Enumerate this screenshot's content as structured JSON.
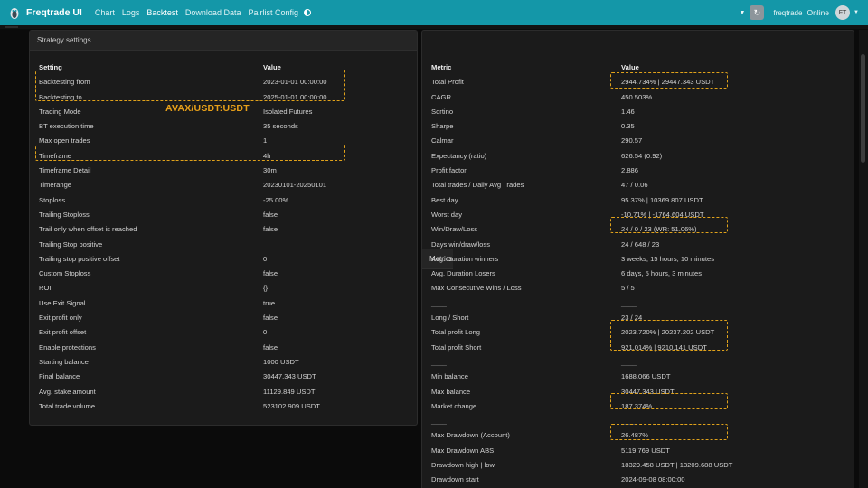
{
  "nav": {
    "brand": "Freqtrade UI",
    "links": [
      "Chart",
      "Logs",
      "Backtest",
      "Download Data",
      "Pairlist Config"
    ],
    "active": "Backtest",
    "bot_name": "freqtrade",
    "status": "Online",
    "avatar_initials": "FT"
  },
  "annotation": "AVAX/USDT:USDT",
  "colors": {
    "topbar": "#1497a8",
    "highlight": "#e0a21b"
  },
  "strategy": {
    "title": "Strategy settings",
    "col_key": "Setting",
    "col_value": "Value",
    "rows": [
      {
        "k": "Backtesting from",
        "v": "2023-01-01 00:00:00"
      },
      {
        "k": "Backtesting to",
        "v": "2025-01-01 00:00:00"
      },
      {
        "k": "Trading Mode",
        "v": "Isolated Futures"
      },
      {
        "k": "BT execution time",
        "v": "35 seconds"
      },
      {
        "k": "Max open trades",
        "v": "1"
      },
      {
        "k": "Timeframe",
        "v": "4h"
      },
      {
        "k": "Timeframe Detail",
        "v": "30m"
      },
      {
        "k": "Timerange",
        "v": "20230101-20250101"
      },
      {
        "k": "Stoploss",
        "v": "-25.00%"
      },
      {
        "k": "Trailing Stoploss",
        "v": "false"
      },
      {
        "k": "Trail only when offset is reached",
        "v": "false"
      },
      {
        "k": "Trailing Stop positive",
        "v": ""
      },
      {
        "k": "Trailing stop positive offset",
        "v": "0"
      },
      {
        "k": "Custom Stoploss",
        "v": "false"
      },
      {
        "k": "ROI",
        "v": "{}"
      },
      {
        "k": "Use Exit Signal",
        "v": "true"
      },
      {
        "k": "Exit profit only",
        "v": "false"
      },
      {
        "k": "Exit profit offset",
        "v": "0"
      },
      {
        "k": "Enable protections",
        "v": "false"
      },
      {
        "k": "Starting balance",
        "v": "1000 USDT"
      },
      {
        "k": "Final balance",
        "v": "30447.343 USDT"
      },
      {
        "k": "Avg. stake amount",
        "v": "11129.849 USDT"
      },
      {
        "k": "Total trade volume",
        "v": "523102.909 USDT"
      }
    ]
  },
  "metrics": {
    "title": "Metrics",
    "col_key": "Metric",
    "col_value": "Value",
    "rows": [
      {
        "k": "Total Profit",
        "v": "2944.734% | 29447.343 USDT"
      },
      {
        "k": "CAGR",
        "v": "450.503%"
      },
      {
        "k": "Sortino",
        "v": "1.46"
      },
      {
        "k": "Sharpe",
        "v": "0.35"
      },
      {
        "k": "Calmar",
        "v": "290.57"
      },
      {
        "k": "Expectancy (ratio)",
        "v": "626.54 (0.92)"
      },
      {
        "k": "Profit factor",
        "v": "2.886"
      },
      {
        "k": "Total trades / Daily Avg Trades",
        "v": "47 / 0.06"
      },
      {
        "k": "Best day",
        "v": "95.37% | 10369.807 USDT"
      },
      {
        "k": "Worst day",
        "v": "-10.71% | -1764.604 USDT"
      },
      {
        "k": "Win/Draw/Loss",
        "v": "24 / 0 / 23 (WR: 51.06%)"
      },
      {
        "k": "Days win/draw/loss",
        "v": "24 / 648 / 23"
      },
      {
        "k": "Avg. Duration winners",
        "v": "3 weeks, 15 hours, 10 minutes"
      },
      {
        "k": "Avg. Duration Losers",
        "v": "6 days, 5 hours, 3 minutes"
      },
      {
        "k": "Max Consecutive Wins / Loss",
        "v": "5 / 5"
      },
      {
        "k": "____",
        "v": "____"
      },
      {
        "k": "Long / Short",
        "v": "23 / 24"
      },
      {
        "k": "Total profit Long",
        "v": "2023.720% | 20237.202 USDT"
      },
      {
        "k": "Total profit Short",
        "v": "921.014% | 9210.141 USDT"
      },
      {
        "k": "____",
        "v": "____"
      },
      {
        "k": "Min balance",
        "v": "1688.066 USDT"
      },
      {
        "k": "Max balance",
        "v": "30447.343 USDT"
      },
      {
        "k": "Market change",
        "v": "187.374%"
      },
      {
        "k": "____",
        "v": "____"
      },
      {
        "k": "Max Drawdown (Account)",
        "v": "26.487%"
      },
      {
        "k": "Max Drawdown ABS",
        "v": "5119.769 USDT"
      },
      {
        "k": "Drawdown high | low",
        "v": "18329.458 USDT | 13209.688 USDT"
      },
      {
        "k": "Drawdown start",
        "v": "2024-09-08 08:00:00"
      }
    ]
  }
}
